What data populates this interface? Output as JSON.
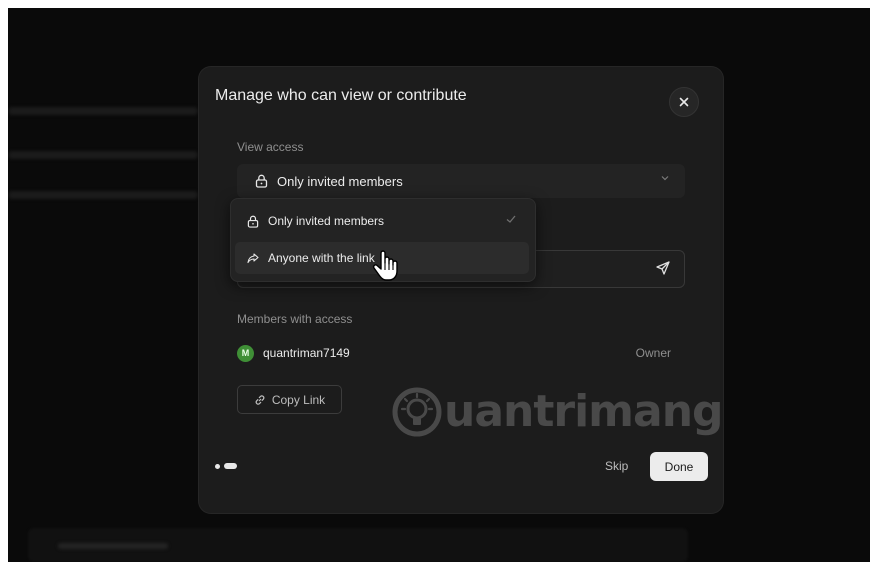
{
  "modal": {
    "title": "Manage who can view or contribute",
    "close_icon": "close-icon"
  },
  "view_access": {
    "label": "View access",
    "selected": "Only invited members",
    "options": [
      {
        "label": "Only invited members",
        "icon": "lock-icon",
        "selected": true
      },
      {
        "label": "Anyone with the link",
        "icon": "share-icon",
        "selected": false
      }
    ]
  },
  "invite": {
    "send_icon": "send-icon"
  },
  "members": {
    "label": "Members with access",
    "list": [
      {
        "avatar": "M",
        "name": "quantriman7149",
        "role": "Owner",
        "avatar_color": "#3f8f36"
      }
    ]
  },
  "copy_link": {
    "label": "Copy Link",
    "icon": "link-icon"
  },
  "footer": {
    "skip_label": "Skip",
    "done_label": "Done",
    "pages": 2,
    "current_page": 2
  },
  "watermark": {
    "text": "uantrimang"
  },
  "colors": {
    "modal_bg": "#1c1c1c",
    "screen_bg": "#0a0a0a",
    "done_bg": "#ececec",
    "avatar": "#3f8f36"
  }
}
